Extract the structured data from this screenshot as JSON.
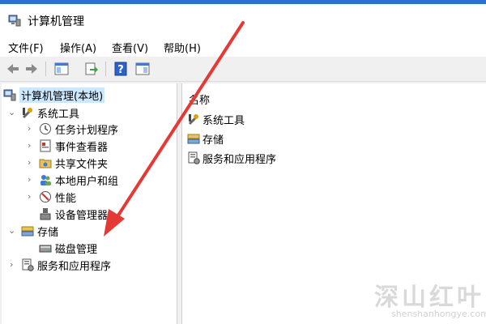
{
  "window": {
    "title": "计算机管理",
    "accent_color": "#2b6fd2",
    "annotation_arrow_color": "#e53935"
  },
  "menu": [
    {
      "label": "文件(F)"
    },
    {
      "label": "操作(A)"
    },
    {
      "label": "查看(V)"
    },
    {
      "label": "帮助(H)"
    }
  ],
  "toolbar": {
    "buttons": [
      "back-arrow-icon",
      "forward-arrow-icon",
      "console-tree-icon",
      "export-icon",
      "help-icon",
      "panel-icon"
    ]
  },
  "tree": {
    "root": {
      "label": "计算机管理(本地)",
      "icon": "computer-management-icon"
    },
    "system_tools": {
      "label": "系统工具",
      "icon": "tools-icon",
      "children": [
        {
          "label": "任务计划程序",
          "icon": "clock-icon"
        },
        {
          "label": "事件查看器",
          "icon": "event-viewer-icon"
        },
        {
          "label": "共享文件夹",
          "icon": "shared-folder-icon"
        },
        {
          "label": "本地用户和组",
          "icon": "users-icon"
        },
        {
          "label": "性能",
          "icon": "performance-icon"
        },
        {
          "label": "设备管理器",
          "icon": "device-manager-icon"
        }
      ]
    },
    "storage": {
      "label": "存储",
      "icon": "storage-icon",
      "children": [
        {
          "label": "磁盘管理",
          "icon": "disk-icon"
        }
      ]
    },
    "services": {
      "label": "服务和应用程序",
      "icon": "services-icon"
    }
  },
  "list": {
    "column_header": "名称",
    "items": [
      {
        "label": "系统工具",
        "icon": "tools-icon"
      },
      {
        "label": "存储",
        "icon": "storage-icon"
      },
      {
        "label": "服务和应用程序",
        "icon": "services-icon"
      }
    ]
  },
  "watermark": {
    "main": "深山红叶",
    "sub": "shenshanhongye.com"
  }
}
